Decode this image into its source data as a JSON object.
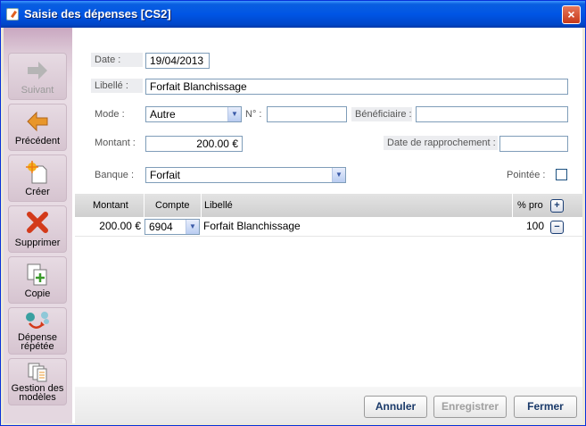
{
  "window": {
    "title": "Saisie des dépenses [CS2]",
    "close": "×"
  },
  "sidebar": {
    "items": [
      {
        "label": "Suivant",
        "enabled": false
      },
      {
        "label": "Précédent",
        "enabled": true
      },
      {
        "label": "Créer",
        "enabled": true
      },
      {
        "label": "Supprimer",
        "enabled": true
      },
      {
        "label": "Copie",
        "enabled": true
      },
      {
        "label": "Dépense répétée",
        "enabled": true
      },
      {
        "label": "Gestion des modèles",
        "enabled": true
      }
    ]
  },
  "form": {
    "date_label": "Date :",
    "date_value": "19/04/2013",
    "libelle_label": "Libellé :",
    "libelle_value": "Forfait Blanchissage",
    "mode_label": "Mode :",
    "mode_value": "Autre",
    "numero_label": "N° :",
    "numero_value": "",
    "beneficiaire_label": "Bénéficiaire :",
    "beneficiaire_value": "",
    "montant_label": "Montant :",
    "montant_value": "200.00 €",
    "rapprochement_label": "Date de rapprochement :",
    "rapprochement_value": "",
    "banque_label": "Banque :",
    "banque_value": "Forfait",
    "pointee_label": "Pointée :",
    "pointee_checked": false
  },
  "grid": {
    "headers": {
      "montant": "Montant",
      "compte": "Compte",
      "libelle": "Libellé",
      "pro": "% pro"
    },
    "add_label": "+",
    "rows": [
      {
        "montant": "200.00 €",
        "compte": "6904",
        "libelle": "Forfait Blanchissage",
        "pro": "100",
        "remove_label": "−"
      }
    ]
  },
  "footer": {
    "annuler": "Annuler",
    "enregistrer": "Enregistrer",
    "fermer": "Fermer"
  },
  "colors": {
    "titlebar": "#0055e5",
    "sidebar": "#e4d7e0",
    "accent_orange": "#e8962a",
    "delete_red": "#d33a1a"
  }
}
